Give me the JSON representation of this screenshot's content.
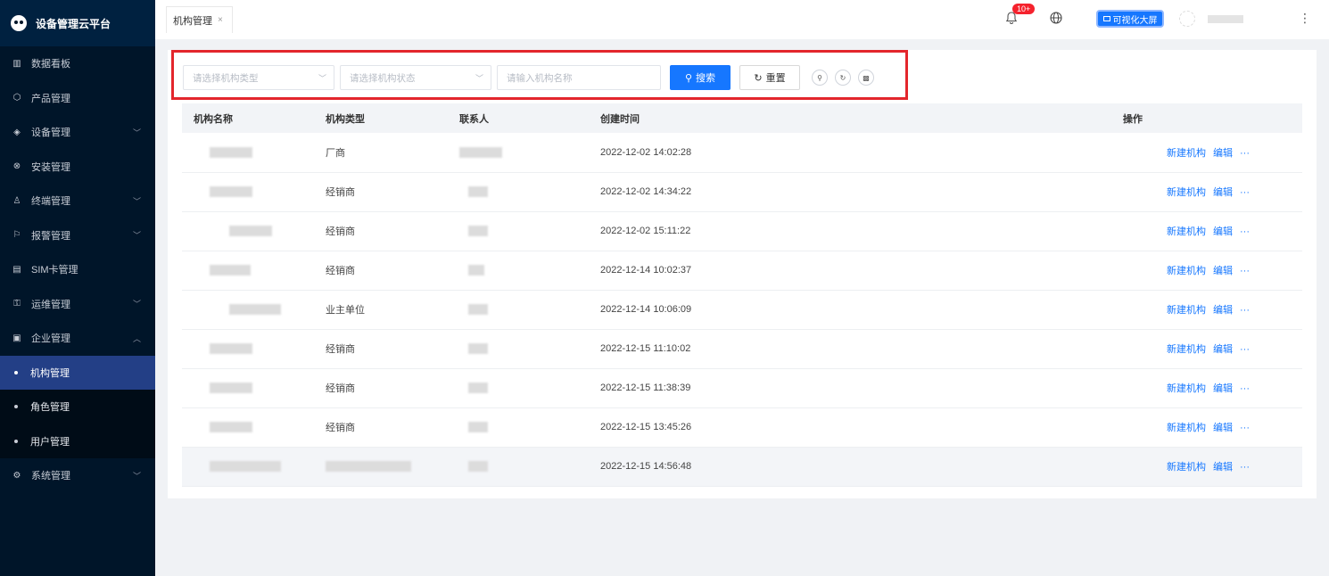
{
  "app": {
    "title": "设备管理云平台"
  },
  "sidebar": {
    "items": [
      {
        "label": "数据看板",
        "icon": "bar-chart-icon",
        "has_children": false
      },
      {
        "label": "产品管理",
        "icon": "cube-icon",
        "has_children": false
      },
      {
        "label": "设备管理",
        "icon": "layers-icon",
        "has_children": true
      },
      {
        "label": "安装管理",
        "icon": "tool-icon",
        "has_children": false
      },
      {
        "label": "终端管理",
        "icon": "user-icon",
        "has_children": true
      },
      {
        "label": "报警管理",
        "icon": "alarm-icon",
        "has_children": true
      },
      {
        "label": "SIM卡管理",
        "icon": "sim-icon",
        "has_children": false
      },
      {
        "label": "运维管理",
        "icon": "wrench-icon",
        "has_children": true
      },
      {
        "label": "企业管理",
        "icon": "building-icon",
        "has_children": true,
        "expanded": true
      }
    ],
    "sub_items": [
      {
        "label": "机构管理",
        "active": true
      },
      {
        "label": "角色管理",
        "active": false
      },
      {
        "label": "用户管理",
        "active": false
      }
    ],
    "last_item": {
      "label": "系统管理",
      "icon": "settings-icon",
      "has_children": true
    }
  },
  "header": {
    "tab_label": "机构管理",
    "tab_close": "×",
    "notification_badge": "10+",
    "visual_button": "可视化大屏",
    "more_icon": "⋮"
  },
  "filters": {
    "type_placeholder": "请选择机构类型",
    "status_placeholder": "请选择机构状态",
    "name_placeholder": "请输入机构名称",
    "search_label": "搜索",
    "reset_label": "重置"
  },
  "table": {
    "columns": [
      "机构名称",
      "机构类型",
      "联系人",
      "创建时间",
      "操作"
    ],
    "rows": [
      {
        "type": "厂商",
        "created": "2022-12-02 14:02:28"
      },
      {
        "type": "经销商",
        "created": "2022-12-02 14:34:22"
      },
      {
        "type": "经销商",
        "created": "2022-12-02 15:11:22"
      },
      {
        "type": "经销商",
        "created": "2022-12-14 10:02:37"
      },
      {
        "type": "业主单位",
        "created": "2022-12-14 10:06:09"
      },
      {
        "type": "经销商",
        "created": "2022-12-15 11:10:02"
      },
      {
        "type": "经销商",
        "created": "2022-12-15 11:38:39"
      },
      {
        "type": "经销商",
        "created": "2022-12-15 13:45:26"
      },
      {
        "type": "",
        "created": "2022-12-15 14:56:48"
      }
    ],
    "actions": {
      "new": "新建机构",
      "edit": "编辑",
      "more": "···"
    }
  },
  "colors": {
    "accent": "#1677ff",
    "sidebar_bg": "#001529",
    "highlight": "#e3262c"
  }
}
